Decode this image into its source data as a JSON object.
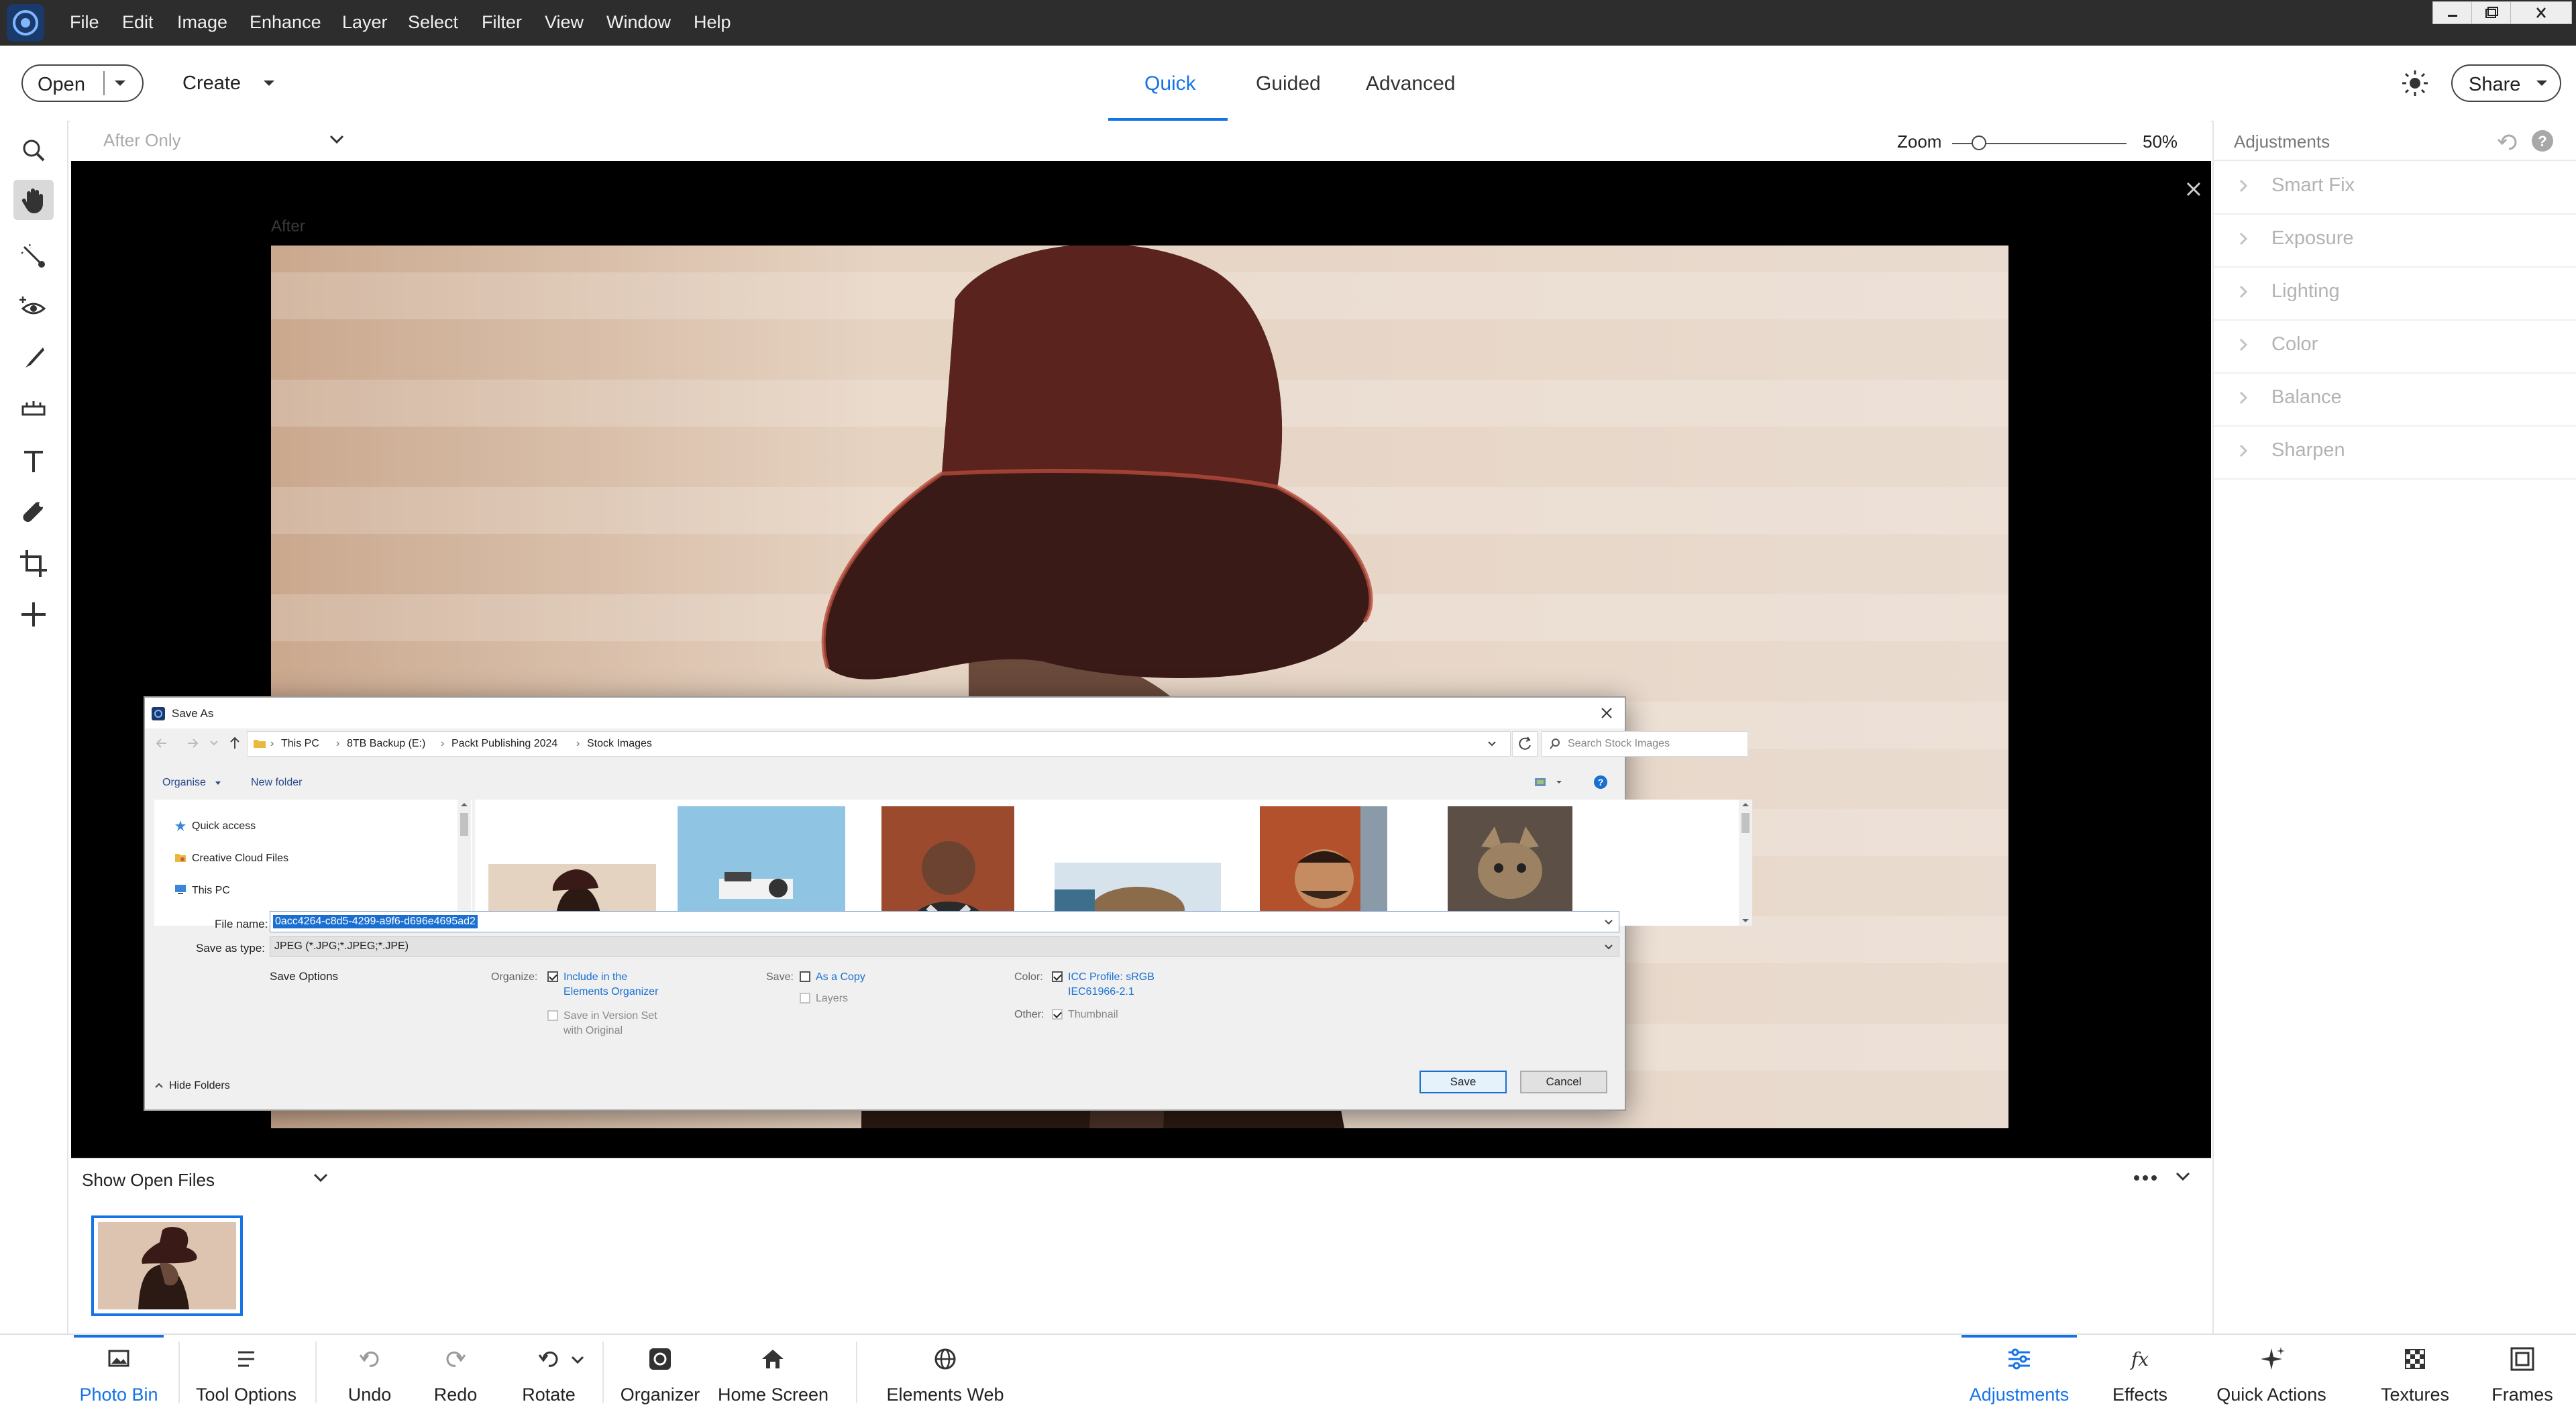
{
  "menu": [
    "File",
    "Edit",
    "Image",
    "Enhance",
    "Layer",
    "Select",
    "Filter",
    "View",
    "Window",
    "Help"
  ],
  "topbar": {
    "open_label": "Open",
    "create_label": "Create",
    "tabs": [
      "Quick",
      "Guided",
      "Advanced"
    ],
    "active_tab": "Quick",
    "share_label": "Share"
  },
  "options": {
    "view_select": "After Only",
    "zoom_label": "Zoom",
    "zoom_value": "50%",
    "zoom_fraction": 0.12
  },
  "canvas": {
    "after_label": "After"
  },
  "adjustments": {
    "title": "Adjustments",
    "items": [
      "Smart Fix",
      "Exposure",
      "Lighting",
      "Color",
      "Balance",
      "Sharpen"
    ]
  },
  "photobin": {
    "dropdown": "Show Open Files"
  },
  "bottombar": {
    "items": [
      "Photo Bin",
      "Tool Options",
      "Undo",
      "Redo",
      "Rotate",
      "Organizer",
      "Home Screen",
      "Elements Web"
    ],
    "right_items": [
      "Adjustments",
      "Effects",
      "Quick Actions",
      "Textures",
      "Frames"
    ]
  },
  "dialog": {
    "title": "Save As",
    "breadcrumb": [
      "This PC",
      "8TB Backup (E:)",
      "Packt Publishing 2024",
      "Stock Images"
    ],
    "search_placeholder": "Search Stock Images",
    "organise": "Organise",
    "new_folder": "New folder",
    "nav_items": [
      "Quick access",
      "Creative Cloud Files",
      "This PC"
    ],
    "file_name_label": "File name:",
    "file_name_value": "0acc4264-c8d5-4299-a9f6-d696e4695ad2",
    "save_type_label": "Save as type:",
    "save_type_value": "JPEG (*.JPG;*.JPEG;*.JPE)",
    "save_options_label": "Save Options",
    "organize_label": "Organize:",
    "include_organizer_1": "Include in the",
    "include_organizer_2": "Elements Organizer",
    "version_set_1": "Save in Version Set",
    "version_set_2": "with Original",
    "save_label": "Save:",
    "as_copy": "As a Copy",
    "layers": "Layers",
    "color_label": "Color:",
    "icc_1": "ICC Profile:  sRGB",
    "icc_2": "IEC61966-2.1",
    "other_label": "Other:",
    "thumbnail": "Thumbnail",
    "hide_folders": "Hide Folders",
    "save_button": "Save",
    "cancel_button": "Cancel"
  },
  "colors": {
    "accent": "#1473e6",
    "titlebar": "#2d2d2d",
    "canvas": "#000000"
  }
}
